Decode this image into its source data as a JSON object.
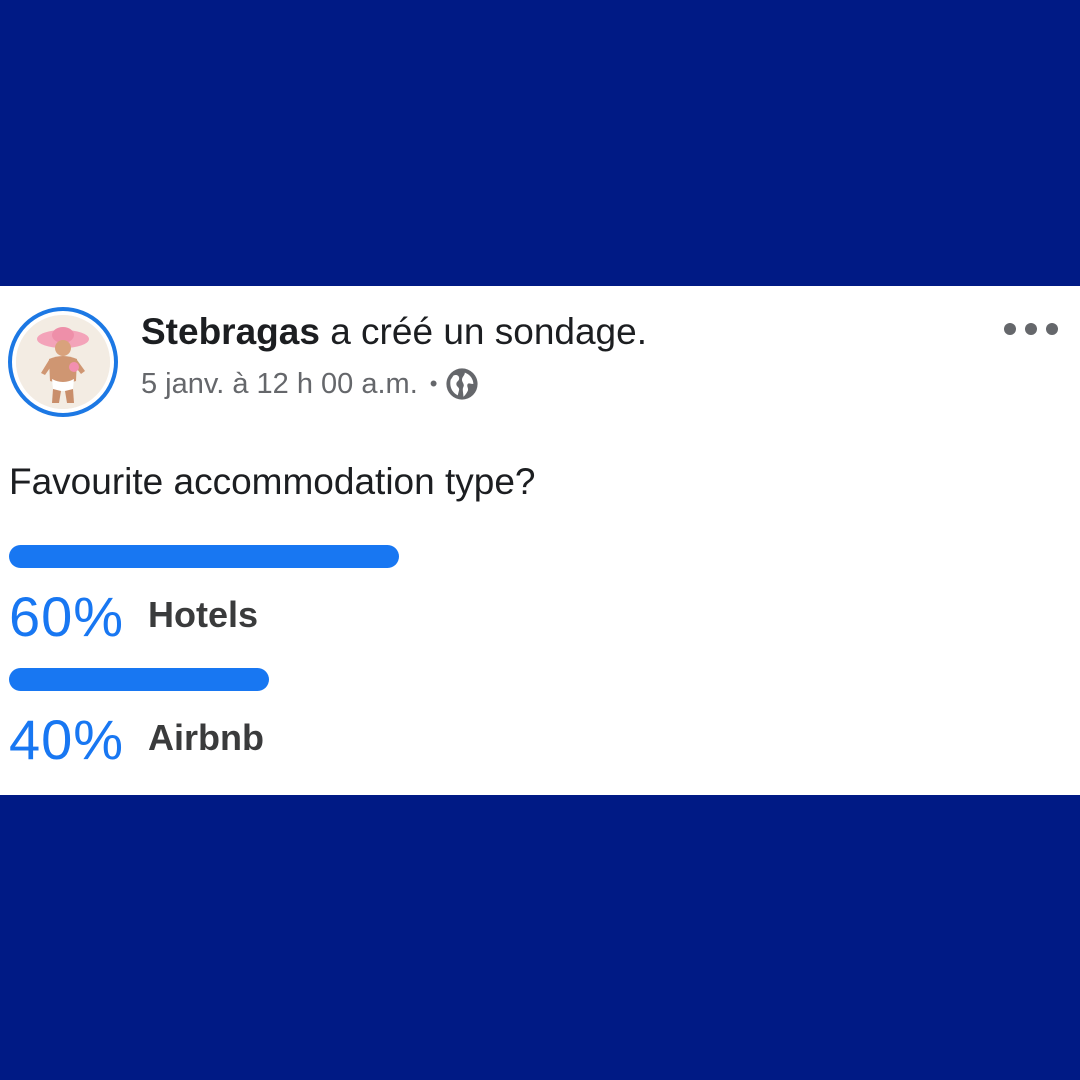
{
  "colors": {
    "page_background": "#001a85",
    "card_background": "#ffffff",
    "accent_blue": "#1877f2",
    "avatar_ring": "#1c78e4",
    "primary_text": "#1c1e21",
    "secondary_text": "#65676b"
  },
  "post": {
    "author_name": "Stebragas",
    "action_text": " a créé un sondage.",
    "timestamp": "5 janv. à 12 h 00 a.m.",
    "meta_separator": "•",
    "privacy_icon": "globe-icon",
    "more_icon": "more-options-icon",
    "avatar_icon": "profile-avatar"
  },
  "poll": {
    "question": "Favourite accommodation type?",
    "options": [
      {
        "percent_label": "60%",
        "label": "Hotels",
        "fraction": 0.6
      },
      {
        "percent_label": "40%",
        "label": "Airbnb",
        "fraction": 0.4
      }
    ]
  }
}
